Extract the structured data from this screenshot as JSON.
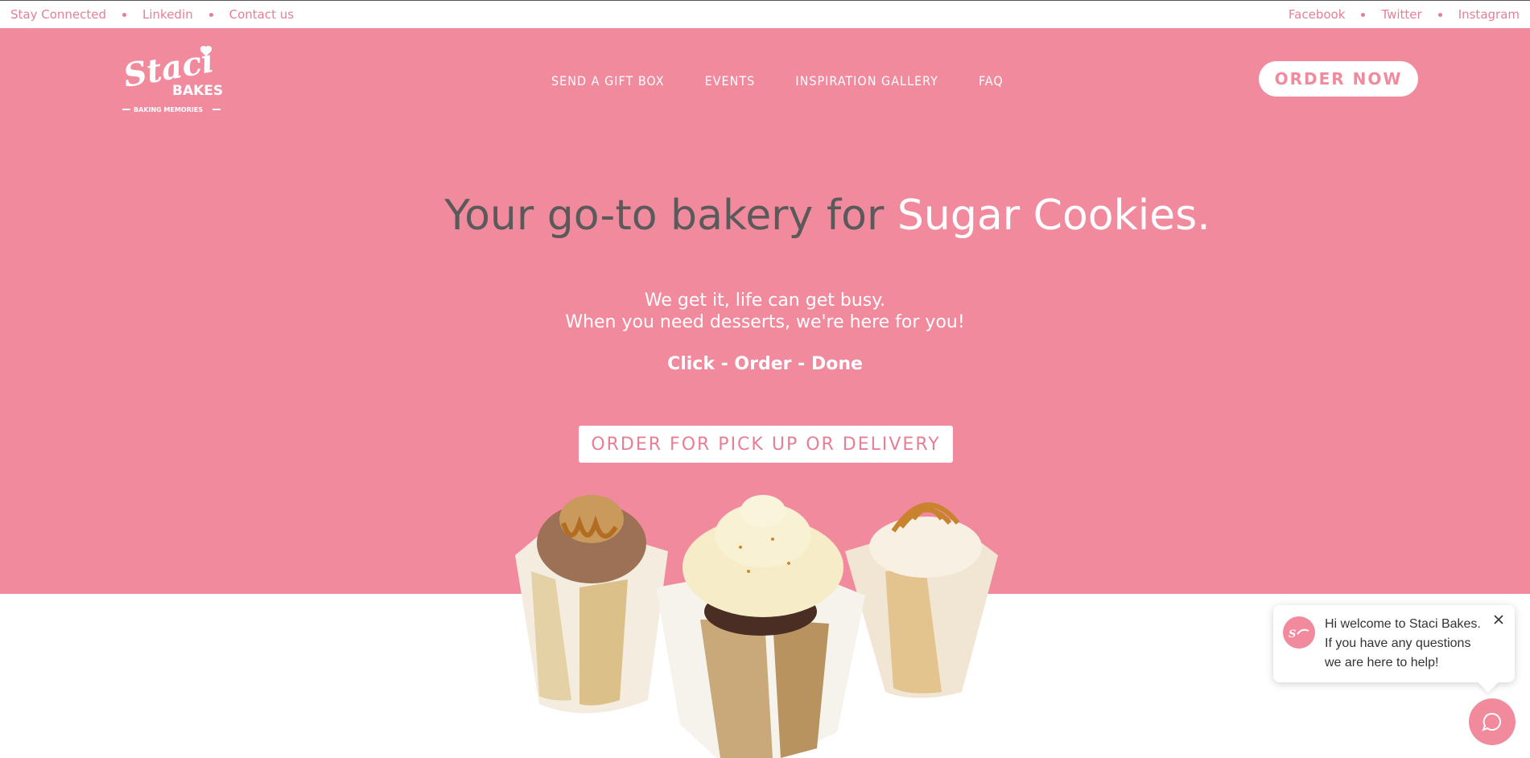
{
  "topbar": {
    "left_links": [
      "Stay Connected",
      "Linkedin",
      "Contact us"
    ],
    "right_links": [
      "Facebook",
      "Twitter",
      "Instagram"
    ]
  },
  "header": {
    "logo": {
      "script": "Staci",
      "word": "BAKES",
      "tagline": "BAKING MEMORIES"
    },
    "nav": [
      "SEND A GIFT BOX",
      "EVENTS",
      "INSPIRATION GALLERY",
      "FAQ"
    ],
    "order_now_label": "ORDER NOW"
  },
  "hero": {
    "headline_prefix": "Your go-to bakery for ",
    "headline_highlight": "Sugar Cookies.",
    "subtext_line1": "We get it, life can get busy.",
    "subtext_line2": "When you need desserts, we're here for you!",
    "tagline": "Click - Order - Done",
    "cta_label": "ORDER FOR PICK UP OR DELIVERY"
  },
  "chat": {
    "line1": "Hi welcome to Staci Bakes.",
    "line2": "If you have any questions",
    "line3": "we are here to help!"
  },
  "colors": {
    "brand_pink": "#f28a9e",
    "link_pink": "#e57f95",
    "headline_gray": "#5a5a5a"
  },
  "icons": {
    "chat_close": "close-icon",
    "chat_launcher": "chat-bubble-icon",
    "topbar_separator": "dot-icon"
  }
}
